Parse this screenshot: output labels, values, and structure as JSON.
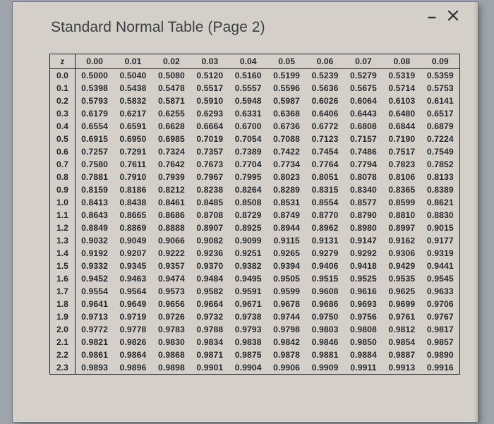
{
  "title": "Standard Normal Table (Page 2)",
  "chart_data": {
    "type": "table",
    "corner_label": "z",
    "col_headers": [
      "0.00",
      "0.01",
      "0.02",
      "0.03",
      "0.04",
      "0.05",
      "0.06",
      "0.07",
      "0.08",
      "0.09"
    ],
    "row_headers": [
      "0.0",
      "0.1",
      "0.2",
      "0.3",
      "0.4",
      "0.5",
      "0.6",
      "0.7",
      "0.8",
      "0.9",
      "1.0",
      "1.1",
      "1.2",
      "1.3",
      "1.4",
      "1.5",
      "1.6",
      "1.7",
      "1.8",
      "1.9",
      "2.0",
      "2.1",
      "2.2",
      "2.3"
    ],
    "values": [
      [
        "0.5000",
        "0.5040",
        "0.5080",
        "0.5120",
        "0.5160",
        "0.5199",
        "0.5239",
        "0.5279",
        "0.5319",
        "0.5359"
      ],
      [
        "0.5398",
        "0.5438",
        "0.5478",
        "0.5517",
        "0.5557",
        "0.5596",
        "0.5636",
        "0.5675",
        "0.5714",
        "0.5753"
      ],
      [
        "0.5793",
        "0.5832",
        "0.5871",
        "0.5910",
        "0.5948",
        "0.5987",
        "0.6026",
        "0.6064",
        "0.6103",
        "0.6141"
      ],
      [
        "0.6179",
        "0.6217",
        "0.6255",
        "0.6293",
        "0.6331",
        "0.6368",
        "0.6406",
        "0.6443",
        "0.6480",
        "0.6517"
      ],
      [
        "0.6554",
        "0.6591",
        "0.6628",
        "0.6664",
        "0.6700",
        "0.6736",
        "0.6772",
        "0.6808",
        "0.6844",
        "0.6879"
      ],
      [
        "0.6915",
        "0.6950",
        "0.6985",
        "0.7019",
        "0.7054",
        "0.7088",
        "0.7123",
        "0.7157",
        "0.7190",
        "0.7224"
      ],
      [
        "0.7257",
        "0.7291",
        "0.7324",
        "0.7357",
        "0.7389",
        "0.7422",
        "0.7454",
        "0.7486",
        "0.7517",
        "0.7549"
      ],
      [
        "0.7580",
        "0.7611",
        "0.7642",
        "0.7673",
        "0.7704",
        "0.7734",
        "0.7764",
        "0.7794",
        "0.7823",
        "0.7852"
      ],
      [
        "0.7881",
        "0.7910",
        "0.7939",
        "0.7967",
        "0.7995",
        "0.8023",
        "0.8051",
        "0.8078",
        "0.8106",
        "0.8133"
      ],
      [
        "0.8159",
        "0.8186",
        "0.8212",
        "0.8238",
        "0.8264",
        "0.8289",
        "0.8315",
        "0.8340",
        "0.8365",
        "0.8389"
      ],
      [
        "0.8413",
        "0.8438",
        "0.8461",
        "0.8485",
        "0.8508",
        "0.8531",
        "0.8554",
        "0.8577",
        "0.8599",
        "0.8621"
      ],
      [
        "0.8643",
        "0.8665",
        "0.8686",
        "0.8708",
        "0.8729",
        "0.8749",
        "0.8770",
        "0.8790",
        "0.8810",
        "0.8830"
      ],
      [
        "0.8849",
        "0.8869",
        "0.8888",
        "0.8907",
        "0.8925",
        "0.8944",
        "0.8962",
        "0.8980",
        "0.8997",
        "0.9015"
      ],
      [
        "0.9032",
        "0.9049",
        "0.9066",
        "0.9082",
        "0.9099",
        "0.9115",
        "0.9131",
        "0.9147",
        "0.9162",
        "0.9177"
      ],
      [
        "0.9192",
        "0.9207",
        "0.9222",
        "0.9236",
        "0.9251",
        "0.9265",
        "0.9279",
        "0.9292",
        "0.9306",
        "0.9319"
      ],
      [
        "0.9332",
        "0.9345",
        "0.9357",
        "0.9370",
        "0.9382",
        "0.9394",
        "0.9406",
        "0.9418",
        "0.9429",
        "0.9441"
      ],
      [
        "0.9452",
        "0.9463",
        "0.9474",
        "0.9484",
        "0.9495",
        "0.9505",
        "0.9515",
        "0.9525",
        "0.9535",
        "0.9545"
      ],
      [
        "0.9554",
        "0.9564",
        "0.9573",
        "0.9582",
        "0.9591",
        "0.9599",
        "0.9608",
        "0.9616",
        "0.9625",
        "0.9633"
      ],
      [
        "0.9641",
        "0.9649",
        "0.9656",
        "0.9664",
        "0.9671",
        "0.9678",
        "0.9686",
        "0.9693",
        "0.9699",
        "0.9706"
      ],
      [
        "0.9713",
        "0.9719",
        "0.9726",
        "0.9732",
        "0.9738",
        "0.9744",
        "0.9750",
        "0.9756",
        "0.9761",
        "0.9767"
      ],
      [
        "0.9772",
        "0.9778",
        "0.9783",
        "0.9788",
        "0.9793",
        "0.9798",
        "0.9803",
        "0.9808",
        "0.9812",
        "0.9817"
      ],
      [
        "0.9821",
        "0.9826",
        "0.9830",
        "0.9834",
        "0.9838",
        "0.9842",
        "0.9846",
        "0.9850",
        "0.9854",
        "0.9857"
      ],
      [
        "0.9861",
        "0.9864",
        "0.9868",
        "0.9871",
        "0.9875",
        "0.9878",
        "0.9881",
        "0.9884",
        "0.9887",
        "0.9890"
      ],
      [
        "0.9893",
        "0.9896",
        "0.9898",
        "0.9901",
        "0.9904",
        "0.9906",
        "0.9909",
        "0.9911",
        "0.9913",
        "0.9916"
      ]
    ]
  }
}
